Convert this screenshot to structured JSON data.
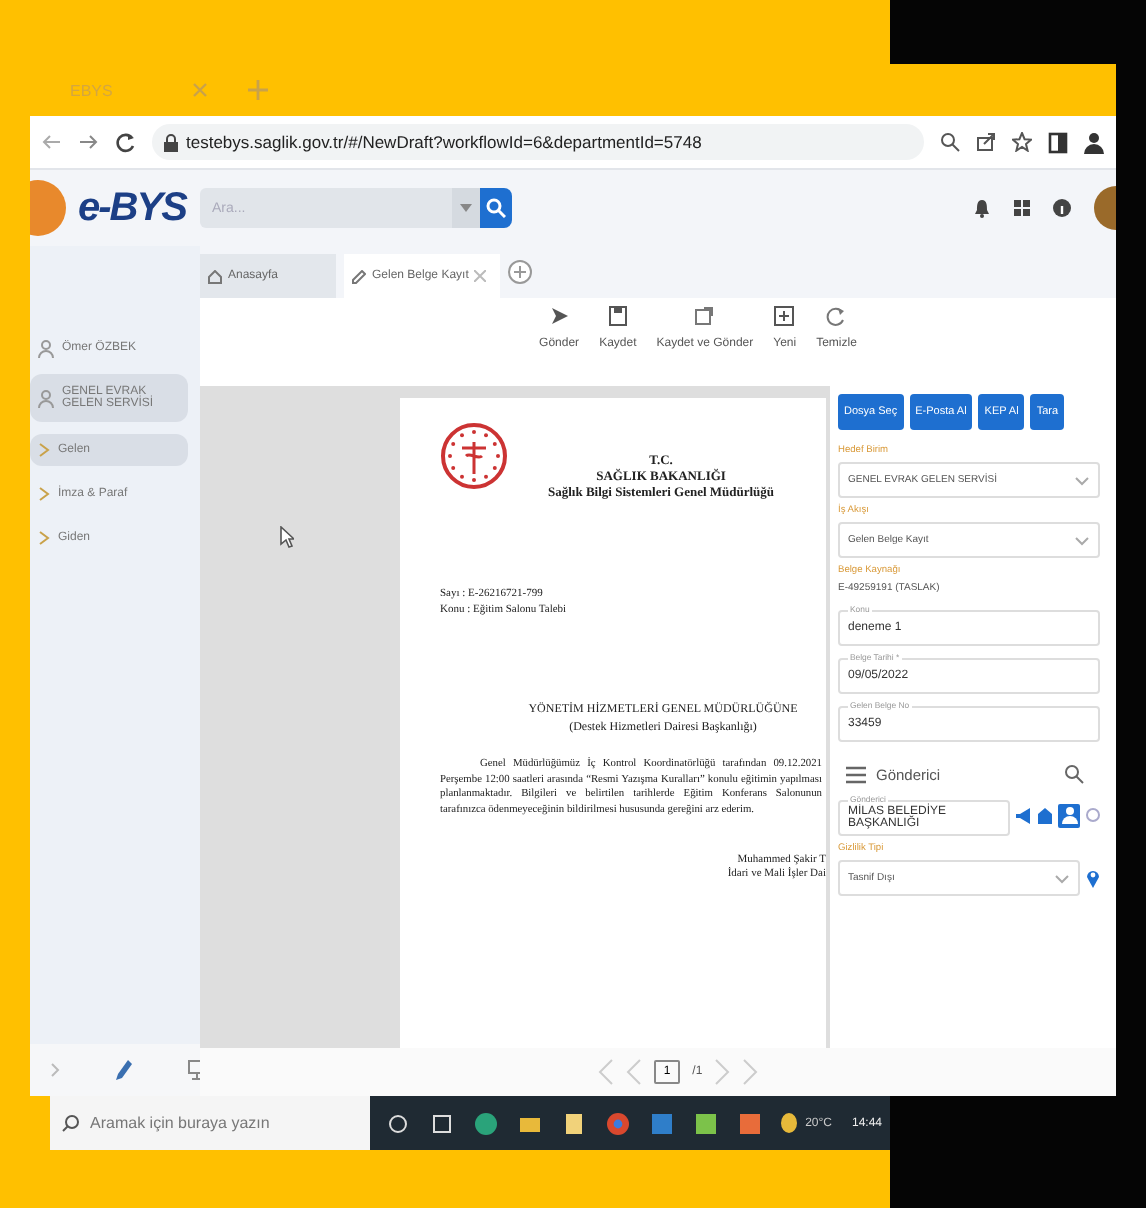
{
  "browser": {
    "tabs": [
      {
        "title": "EBYS"
      }
    ],
    "url": "testebys.saglik.gov.tr/#/NewDraft?workflowId=6&departmentId=5748"
  },
  "app": {
    "logo": "e-BYS",
    "search": {
      "placeholder": "Ara..."
    },
    "doc_tabs": [
      {
        "label": "Anasayfa",
        "selected": false,
        "closable": false
      },
      {
        "label": "Gelen Belge Kayıt",
        "selected": true,
        "closable": true
      }
    ],
    "toolbar": [
      {
        "label": "Gönder"
      },
      {
        "label": "Kaydet"
      },
      {
        "label": "Kaydet ve Gönder"
      },
      {
        "label": "Yeni"
      },
      {
        "label": "Temizle"
      }
    ],
    "sidebar": {
      "user": "Ömer ÖZBEK",
      "unit": {
        "label": "GENEL EVRAK GELEN SERVİSİ",
        "selected": true
      },
      "items": [
        {
          "label": "Gelen",
          "selected": true
        },
        {
          "label": "İmza & Paraf",
          "selected": false
        },
        {
          "label": "Giden",
          "selected": false
        }
      ]
    },
    "document": {
      "header": [
        "T.C.",
        "SAĞLIK BAKANLIĞI",
        "Sağlık Bilgi Sistemleri Genel Müdürlüğü"
      ],
      "meta": [
        "Sayı  : E-26216721-799",
        "Konu : Eğitim Salonu Talebi"
      ],
      "addressee": [
        "YÖNETİM HİZMETLERİ GENEL MÜDÜRLÜĞÜNE",
        "(Destek Hizmetleri Dairesi Başkanlığı)"
      ],
      "body": "Genel Müdürlüğümüz İç Kontrol Koordinatörlüğü tarafından 09.12.2021 Perşembe 12:00 saatleri arasında “Resmi Yazışma Kuralları” konulu eğitimin yapılması planlanmaktadır. Bilgileri ve belirtilen tarihlerde Eğitim Konferans Salonunun tarafınızca ödenmeyeceğinin bildirilmesi hususunda gereğini arz ederim.",
      "signature": [
        "Muhammed Şakir T",
        "İdari ve Mali İşler Dai"
      ]
    },
    "pager": {
      "page": "1",
      "total": "/1"
    },
    "panel": {
      "buttons": [
        "Dosya Seç",
        "E-Posta Al",
        "KEP Al",
        "Tara"
      ],
      "fields": [
        {
          "kind": "select",
          "label": "Hedef Birim",
          "value": "GENEL EVRAK GELEN SERVİSİ"
        },
        {
          "kind": "select",
          "label": "İş Akışı",
          "value": "Gelen Belge Kayıt"
        },
        {
          "kind": "info",
          "label": "Belge Kaynağı",
          "value": "E-49259191 (TASLAK)"
        },
        {
          "kind": "outlined",
          "label": "Konu",
          "value": "deneme 1"
        },
        {
          "kind": "outlined",
          "label": "Belge Tarihi *",
          "value": "09/05/2022"
        },
        {
          "kind": "outlined",
          "label": "Gelen Belge No",
          "value": "33459"
        },
        {
          "kind": "section",
          "label": "Gönderici"
        },
        {
          "kind": "sender",
          "label": "Gönderici",
          "value": "MİLAS BELEDİYE BAŞKANLIĞI"
        },
        {
          "kind": "location",
          "label": "Gizlilik Tipi",
          "value": "Tasnif Dışı"
        }
      ]
    }
  },
  "taskbar": {
    "search": {
      "placeholder": "Aramak için buraya yazın"
    },
    "weather": "20°C",
    "time": "14:44"
  }
}
